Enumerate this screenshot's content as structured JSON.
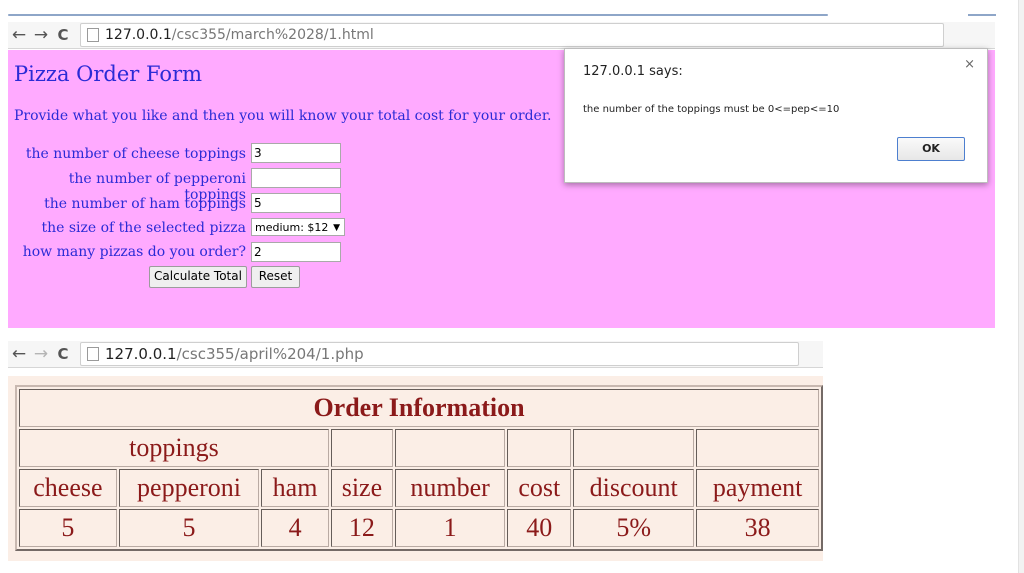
{
  "browser1": {
    "url_host": "127.0.0.1",
    "url_path": "/csc355/march%2028/1.html"
  },
  "form": {
    "title": "Pizza Order Form",
    "description": "Provide what you like and then you will know your total cost for your order.",
    "fields": [
      {
        "label": "the number of cheese toppings",
        "value": "3"
      },
      {
        "label": "the number of pepperoni toppings",
        "value": ""
      },
      {
        "label": "the number of ham toppings",
        "value": "5"
      },
      {
        "label": "the size of the selected pizza",
        "value": "medium: $12"
      },
      {
        "label": "how many pizzas do you order?",
        "value": "2"
      }
    ],
    "calculate_label": "Calculate Total",
    "reset_label": "Reset"
  },
  "dialog": {
    "title": "127.0.0.1 says:",
    "close_glyph": "×",
    "message": "the number of the toppings must be 0<=pep<=10",
    "ok_label": "OK"
  },
  "browser2": {
    "url_host": "127.0.0.1",
    "url_path": "/csc355/april%204/1.php"
  },
  "order_table": {
    "title": "Order Information",
    "group_header": "toppings",
    "columns": [
      "cheese",
      "pepperoni",
      "ham",
      "size",
      "number",
      "cost",
      "discount",
      "payment"
    ],
    "row": [
      "5",
      "5",
      "4",
      "12",
      "1",
      "40",
      "5%",
      "38"
    ]
  },
  "icons": {
    "back": "←",
    "forward": "→",
    "reload": "C",
    "select_arrow": "▼"
  }
}
